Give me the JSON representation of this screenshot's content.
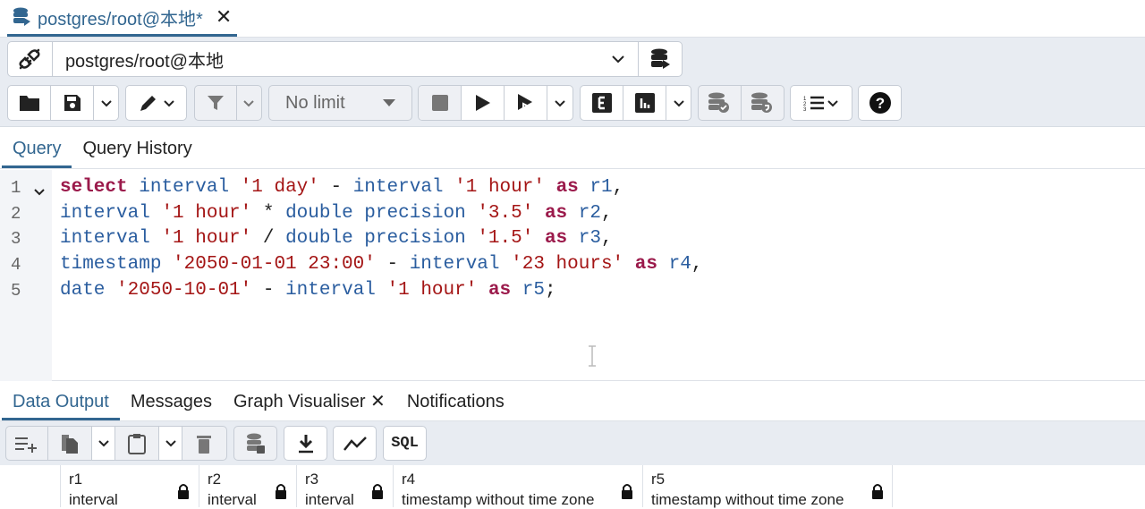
{
  "tab": {
    "title": "postgres/root@本地*",
    "close": "✕"
  },
  "connection": {
    "label": "postgres/root@本地"
  },
  "toolbar": {
    "limit": "No limit"
  },
  "query_tabs": [
    "Query",
    "Query History"
  ],
  "editor": {
    "lines": [
      {
        "n": "1",
        "tokens": [
          [
            "kw",
            "select"
          ],
          [
            "op",
            " "
          ],
          [
            "ty",
            "interval"
          ],
          [
            "op",
            " "
          ],
          [
            "st",
            "'1 day'"
          ],
          [
            "op",
            " - "
          ],
          [
            "ty",
            "interval"
          ],
          [
            "op",
            " "
          ],
          [
            "st",
            "'1 hour'"
          ],
          [
            "op",
            " "
          ],
          [
            "kw",
            "as"
          ],
          [
            "op",
            " "
          ],
          [
            "ty",
            "r1"
          ],
          [
            "op",
            ","
          ]
        ]
      },
      {
        "n": "2",
        "tokens": [
          [
            "ty",
            "interval"
          ],
          [
            "op",
            " "
          ],
          [
            "st",
            "'1 hour'"
          ],
          [
            "op",
            " * "
          ],
          [
            "ty",
            "double precision"
          ],
          [
            "op",
            " "
          ],
          [
            "st",
            "'3.5'"
          ],
          [
            "op",
            " "
          ],
          [
            "kw",
            "as"
          ],
          [
            "op",
            " "
          ],
          [
            "ty",
            "r2"
          ],
          [
            "op",
            ","
          ]
        ]
      },
      {
        "n": "3",
        "tokens": [
          [
            "ty",
            "interval"
          ],
          [
            "op",
            " "
          ],
          [
            "st",
            "'1 hour'"
          ],
          [
            "op",
            " / "
          ],
          [
            "ty",
            "double precision"
          ],
          [
            "op",
            " "
          ],
          [
            "st",
            "'1.5'"
          ],
          [
            "op",
            " "
          ],
          [
            "kw",
            "as"
          ],
          [
            "op",
            " "
          ],
          [
            "ty",
            "r3"
          ],
          [
            "op",
            ","
          ]
        ]
      },
      {
        "n": "4",
        "tokens": [
          [
            "ty",
            "timestamp"
          ],
          [
            "op",
            " "
          ],
          [
            "st",
            "'2050-01-01 23:00'"
          ],
          [
            "op",
            " - "
          ],
          [
            "ty",
            "interval"
          ],
          [
            "op",
            " "
          ],
          [
            "st",
            "'23 hours'"
          ],
          [
            "op",
            " "
          ],
          [
            "kw",
            "as"
          ],
          [
            "op",
            " "
          ],
          [
            "ty",
            "r4"
          ],
          [
            "op",
            ","
          ]
        ]
      },
      {
        "n": "5",
        "tokens": [
          [
            "ty",
            "date"
          ],
          [
            "op",
            " "
          ],
          [
            "st",
            "'2050-10-01'"
          ],
          [
            "op",
            " - "
          ],
          [
            "ty",
            "interval"
          ],
          [
            "op",
            " "
          ],
          [
            "st",
            "'1 hour'"
          ],
          [
            "op",
            " "
          ],
          [
            "kw",
            "as"
          ],
          [
            "op",
            " "
          ],
          [
            "ty",
            "r5"
          ],
          [
            "op",
            ";"
          ]
        ]
      }
    ]
  },
  "result_tabs": {
    "data_output": "Data Output",
    "messages": "Messages",
    "graph": "Graph Visualiser",
    "graph_close": "✕",
    "notifications": "Notifications"
  },
  "result_toolbar": {
    "sql": "SQL"
  },
  "columns": [
    {
      "name": "r1",
      "type": "interval"
    },
    {
      "name": "r2",
      "type": "interval"
    },
    {
      "name": "r3",
      "type": "interval"
    },
    {
      "name": "r4",
      "type": "timestamp without time zone"
    },
    {
      "name": "r5",
      "type": "timestamp without time zone"
    }
  ]
}
